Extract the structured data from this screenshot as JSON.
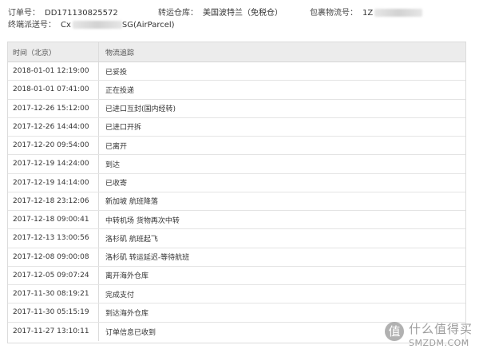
{
  "order_info": {
    "order_no_label": "订单号：",
    "order_no_value": "DD171130825572",
    "warehouse_label": "转运仓库：",
    "warehouse_value": "美国波特兰（免税仓）",
    "parcel_label": "包裹物流号：",
    "parcel_value_prefix": "1Z",
    "delivery_label": "终端派送号：",
    "delivery_value_prefix": "Cx",
    "delivery_value_suffix": "SG(AirParcel)"
  },
  "table": {
    "headers": [
      "时间（北京）",
      "物流追踪"
    ],
    "rows": [
      {
        "time": "2018-01-01 12:19:00",
        "status": "已妥投"
      },
      {
        "time": "2018-01-01 07:41:00",
        "status": "正在投递"
      },
      {
        "time": "2017-12-26 15:12:00",
        "status": "已进口互封(国内经转)"
      },
      {
        "time": "2017-12-26 14:44:00",
        "status": "已进口开拆"
      },
      {
        "time": "2017-12-20 09:54:00",
        "status": "已离开"
      },
      {
        "time": "2017-12-19 14:24:00",
        "status": "到达"
      },
      {
        "time": "2017-12-19 14:14:00",
        "status": "已收寄"
      },
      {
        "time": "2017-12-18 23:12:06",
        "status": "新加坡 航班降落"
      },
      {
        "time": "2017-12-18 09:00:41",
        "status": "中转机场 货物再次中转"
      },
      {
        "time": "2017-12-13 13:00:56",
        "status": "洛杉矶 航班起飞"
      },
      {
        "time": "2017-12-08 09:00:08",
        "status": "洛杉矶 转运延迟-等待航班"
      },
      {
        "time": "2017-12-05 09:07:24",
        "status": "离开海外仓库"
      },
      {
        "time": "2017-11-30 08:19:21",
        "status": "完成支付"
      },
      {
        "time": "2017-11-30 05:15:19",
        "status": "到达海外仓库"
      },
      {
        "time": "2017-11-27 13:10:11",
        "status": "订单信息已收到"
      }
    ]
  },
  "watermark": {
    "badge": "值",
    "top": "什么值得买",
    "bottom": "SMZDM.COM"
  }
}
